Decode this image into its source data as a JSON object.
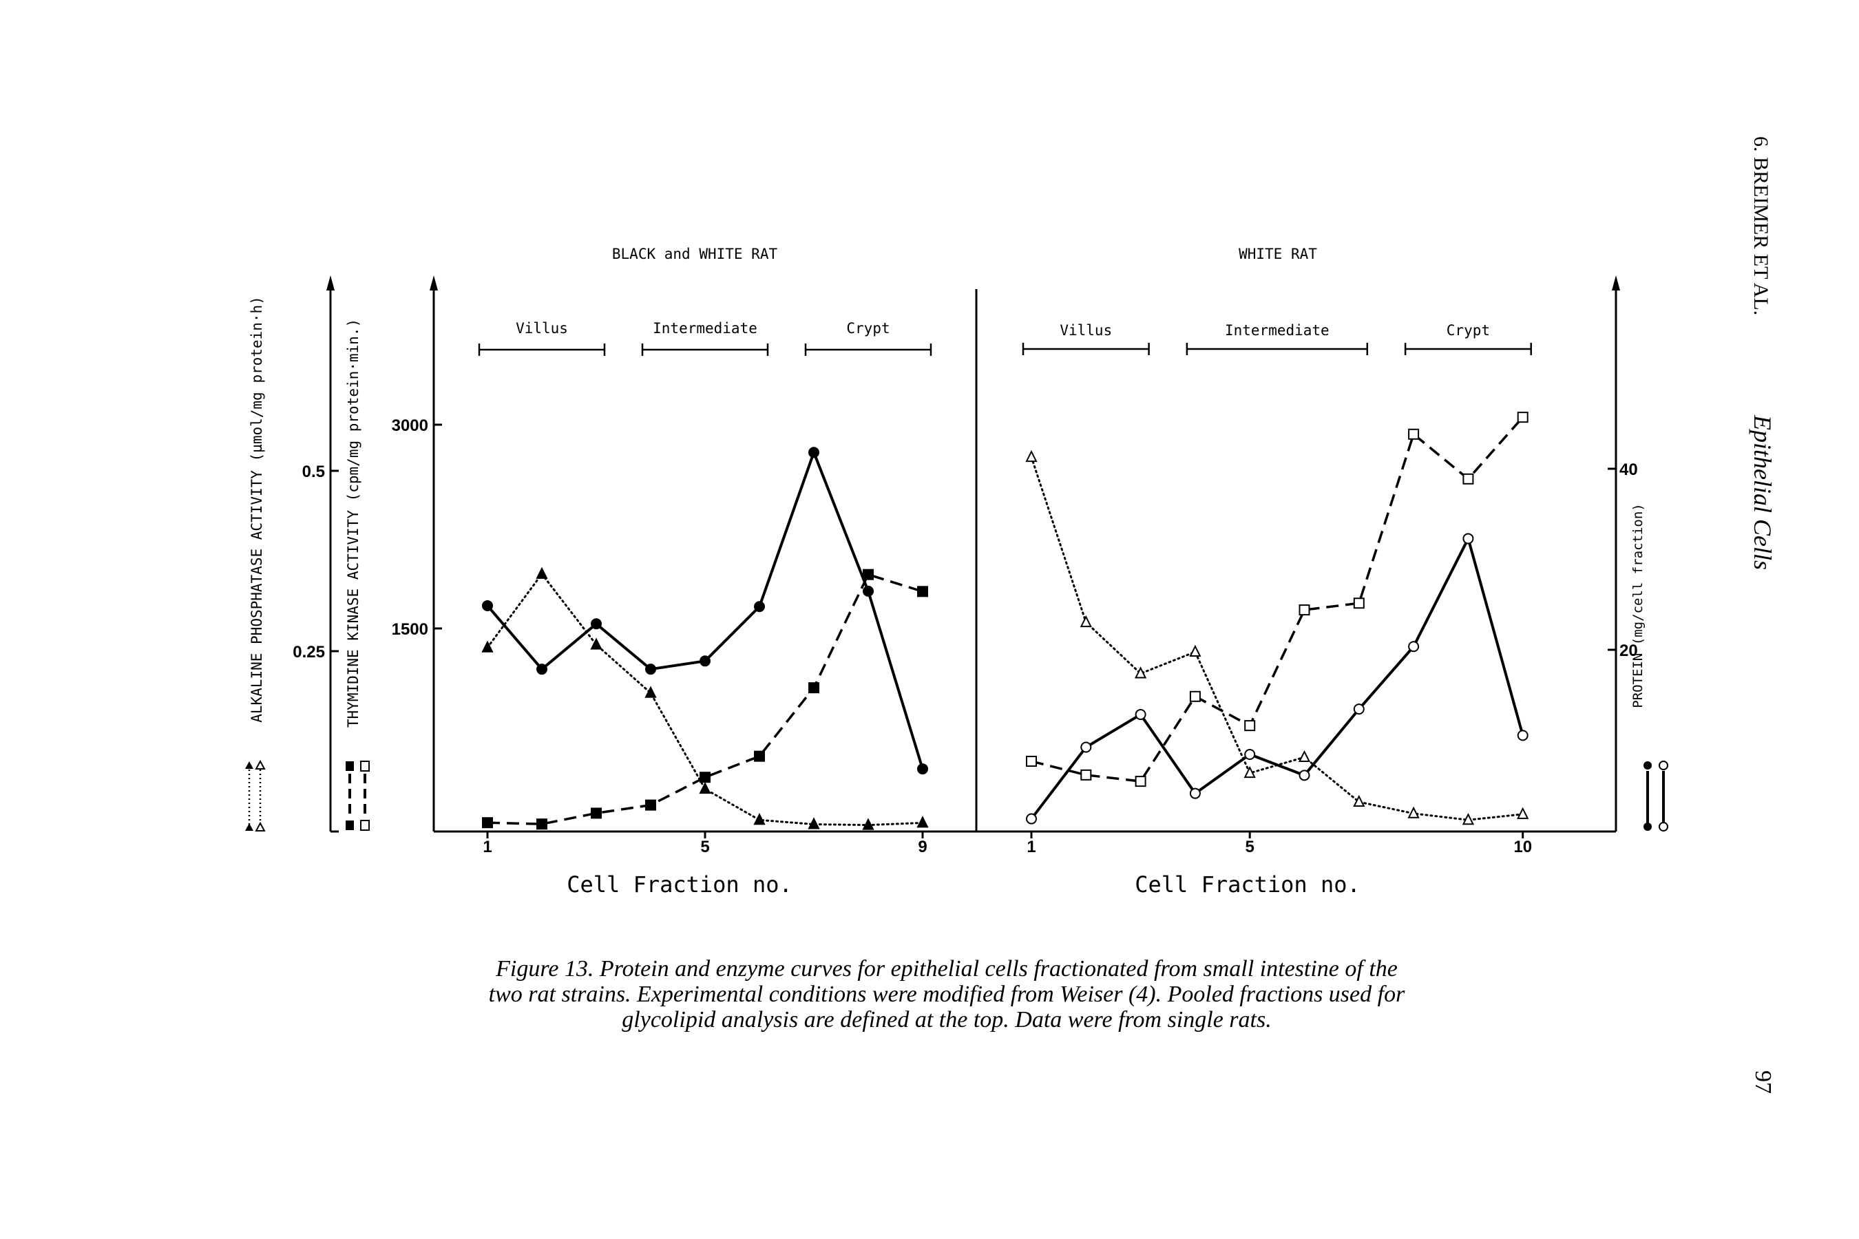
{
  "page": {
    "running_head": "6.  BREIMER ET AL.",
    "running_title": "Epithelial Cells",
    "page_number": "97"
  },
  "caption": {
    "line1": "Figure 13.   Protein and enzyme curves for epithelial cells fractionated from small intestine of the",
    "line2": "two rat strains.  Experimental conditions were modified from Weiser (4).  Pooled fractions used for",
    "line3": "glycolipid analysis are defined at the top.  Data were from single rats."
  },
  "axes": {
    "alkaline_label": "ALKALINE PHOSPHATASE ACTIVITY (µmol/mg protein·h)",
    "alkaline_ticks": [
      "0.25",
      "0.5"
    ],
    "thymidine_label": "THYMIDINE KINASE ACTIVITY (cpm/mg protein·min.)",
    "thymidine_ticks": [
      "1500",
      "3000"
    ],
    "protein_label": "PROTEIN (mg/cell fraction)",
    "protein_ticks": [
      "20",
      "40"
    ]
  },
  "chart_data": [
    {
      "type": "line",
      "title": "BLACK and WHITE RAT",
      "xlabel": "Cell Fraction no.",
      "x": [
        1,
        2,
        3,
        4,
        5,
        6,
        7,
        8,
        9
      ],
      "x_tick_labels": [
        "1",
        "5",
        "9"
      ],
      "pools": [
        {
          "label": "Villus",
          "from": 1,
          "to": 3
        },
        {
          "label": "Intermediate",
          "from": 4,
          "to": 6
        },
        {
          "label": "Crypt",
          "from": 7,
          "to": 9
        }
      ],
      "series": [
        {
          "key": "protein",
          "axis": "protein",
          "style": "solid",
          "marker": "filled-circle",
          "values": [
            24.9,
            17.9,
            22.9,
            17.9,
            18.8,
            24.8,
            41.8,
            26.5,
            6.9
          ]
        },
        {
          "key": "thymidine",
          "axis": "thymidine",
          "style": "dashed",
          "marker": "filled-square",
          "values": [
            65,
            55,
            135,
            195,
            400,
            555,
            1060,
            1895,
            1770
          ]
        },
        {
          "key": "alkaline",
          "axis": "alkaline",
          "style": "dotted",
          "marker": "filled-triangle",
          "values": [
            0.255,
            0.357,
            0.259,
            0.192,
            0.059,
            0.016,
            0.01,
            0.009,
            0.012
          ]
        }
      ]
    },
    {
      "type": "line",
      "title": "WHITE RAT",
      "xlabel": "Cell Fraction no.",
      "x": [
        1,
        2,
        3,
        4,
        5,
        6,
        7,
        8,
        9,
        10
      ],
      "x_tick_labels": [
        "1",
        "5",
        "10"
      ],
      "pools": [
        {
          "label": "Villus",
          "from": 1,
          "to": 3
        },
        {
          "label": "Intermediate",
          "from": 4,
          "to": 7
        },
        {
          "label": "Crypt",
          "from": 8,
          "to": 10
        }
      ],
      "series": [
        {
          "key": "protein",
          "axis": "protein",
          "style": "solid",
          "marker": "open-circle",
          "values": [
            1.4,
            9.3,
            12.9,
            4.2,
            8.5,
            6.2,
            13.5,
            20.4,
            32.3,
            10.6
          ]
        },
        {
          "key": "thymidine",
          "axis": "thymidine",
          "style": "dashed",
          "marker": "open-square",
          "values": [
            518,
            417,
            370,
            996,
            781,
            1634,
            1684,
            2930,
            2600,
            3055
          ]
        },
        {
          "key": "alkaline",
          "axis": "alkaline",
          "style": "dotted",
          "marker": "open-triangle",
          "values": [
            0.519,
            0.29,
            0.219,
            0.249,
            0.081,
            0.103,
            0.041,
            0.025,
            0.016,
            0.024
          ]
        }
      ]
    }
  ],
  "axis_ranges": {
    "alkaline": [
      0,
      0.5
    ],
    "thymidine": [
      0,
      3000
    ],
    "protein": [
      0,
      40
    ]
  },
  "colors": {
    "ink": "#000000",
    "paper": "#ffffff"
  }
}
